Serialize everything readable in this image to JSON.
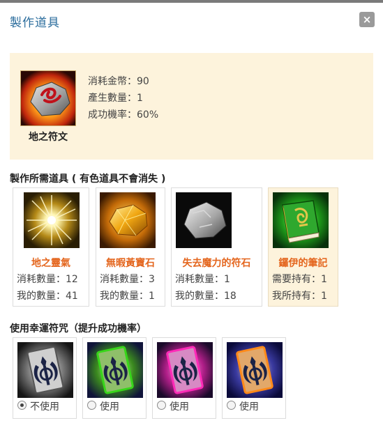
{
  "dialog": {
    "title": "製作道具",
    "close_label": "×"
  },
  "product": {
    "name": "地之符文",
    "icon": "earth-rune-icon",
    "cost_label": "消耗金幣：90",
    "output_label": "產生數量：1",
    "success_label": "成功機率：60%"
  },
  "materials_section": {
    "title": "製作所需道具 ( 有色道具不會消失 )",
    "items": [
      {
        "name": "地之靈氣",
        "icon": "earth-aura-icon",
        "line1": "消耗數量：12",
        "line2": "我的數量：41"
      },
      {
        "name": "無暇黃寶石",
        "icon": "flawless-topaz-icon",
        "line1": "消耗數量：3",
        "line2": "我的數量：1"
      },
      {
        "name": "失去魔力的符石",
        "icon": "powerless-rune-stone-icon",
        "line1": "消耗數量：1",
        "line2": "我的數量：18"
      },
      {
        "name": "鑼伊的筆記",
        "icon": "green-notebook-icon",
        "line1": "需要持有：1",
        "line2": "我所持有：1"
      }
    ]
  },
  "charm_section": {
    "title": "使用幸運符咒（提升成功機率）",
    "options": [
      {
        "label": "不使用",
        "icon": "gray-charm-card-icon",
        "selected": true
      },
      {
        "label": "使用",
        "icon": "green-charm-card-icon",
        "selected": false
      },
      {
        "label": "使用",
        "icon": "pink-charm-card-icon",
        "selected": false
      },
      {
        "label": "使用",
        "icon": "orange-charm-card-icon",
        "selected": false
      }
    ]
  },
  "colors": {
    "title": "#2a6c9c",
    "highlight_panel": "#fdf3dc",
    "material_name": "#e4661e"
  }
}
